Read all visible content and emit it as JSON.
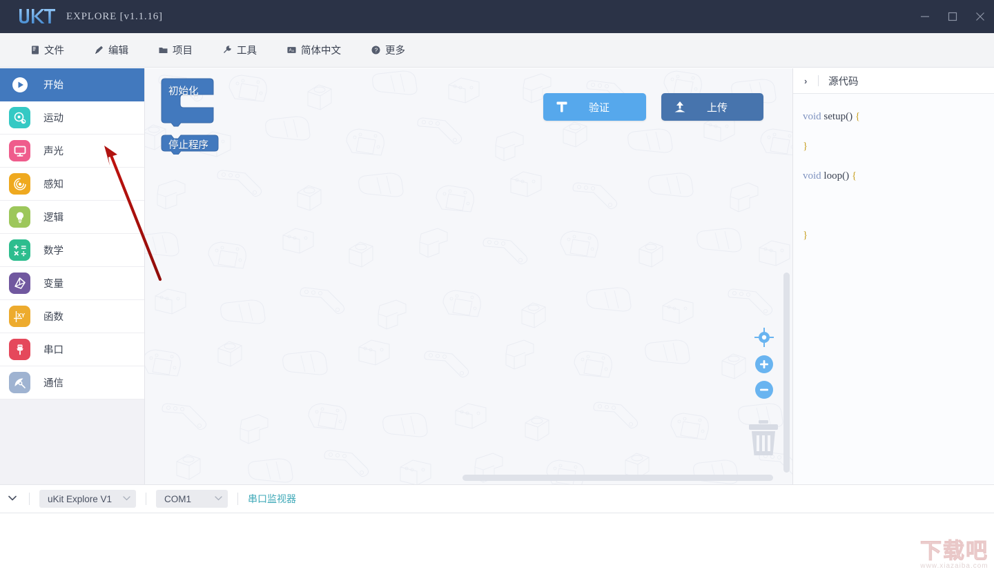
{
  "titlebar": {
    "logo_text": "UKIT",
    "app_title": "EXPLORE [v1.1.16]",
    "minimize": "minimize",
    "maximize": "maximize",
    "close": "close"
  },
  "menubar": {
    "items": [
      {
        "label": "文件",
        "icon": "file-icon"
      },
      {
        "label": "编辑",
        "icon": "edit-pen-icon"
      },
      {
        "label": "项目",
        "icon": "folder-icon"
      },
      {
        "label": "工具",
        "icon": "wrench-icon"
      },
      {
        "label": "简体中文",
        "icon": "language-icon"
      },
      {
        "label": "更多",
        "icon": "help-circle-icon"
      }
    ]
  },
  "sidebar": {
    "items": [
      {
        "label": "开始",
        "icon": "play-circle-icon",
        "color": "#ffffff",
        "active": true
      },
      {
        "label": "运动",
        "icon": "motion-icon",
        "color": "#35c9c4",
        "active": false
      },
      {
        "label": "声光",
        "icon": "display-icon",
        "color": "#ef5c8c",
        "active": false
      },
      {
        "label": "感知",
        "icon": "sensor-icon",
        "color": "#efa91f",
        "active": false
      },
      {
        "label": "逻辑",
        "icon": "bulb-icon",
        "color": "#9dc75b",
        "active": false
      },
      {
        "label": "数学",
        "icon": "math-icon",
        "color": "#2dbd8e",
        "active": false
      },
      {
        "label": "变量",
        "icon": "variable-icon",
        "color": "#71589f",
        "active": false
      },
      {
        "label": "函数",
        "icon": "function-xy-icon",
        "color": "#edab2e",
        "active": false
      },
      {
        "label": "串口",
        "icon": "usb-icon",
        "color": "#e5485b",
        "active": false
      },
      {
        "label": "通信",
        "icon": "satellite-icon",
        "color": "#9fb3d1",
        "active": false
      }
    ]
  },
  "canvas": {
    "blocks": [
      {
        "label": "初始化",
        "type": "c-block"
      },
      {
        "label": "停止程序",
        "type": "cap-block"
      }
    ],
    "buttons": [
      {
        "label": "验证",
        "icon": "hammer-icon",
        "color": "#56a8ec"
      },
      {
        "label": "上传",
        "icon": "upload-icon",
        "color": "#4774ad"
      }
    ],
    "controls": [
      {
        "name": "center-view",
        "icon": "crosshair-icon"
      },
      {
        "name": "zoom-in",
        "icon": "plus-icon"
      },
      {
        "name": "zoom-out",
        "icon": "minus-icon"
      }
    ],
    "trash": "trash-icon"
  },
  "code_panel": {
    "chevron": "›",
    "title": "源代码",
    "lines": [
      {
        "kw": "void",
        "fn": " setup() ",
        "brace": "{"
      },
      {
        "kw": "",
        "fn": "",
        "brace": "}"
      },
      {
        "kw": "void",
        "fn": " loop() ",
        "brace": "{"
      },
      {
        "kw": "",
        "fn": "",
        "brace": "}"
      }
    ],
    "code_text_1": "void",
    "code_text_2": " setup() ",
    "code_text_3": "{",
    "code_text_4": "}",
    "code_text_5": "void",
    "code_text_6": " loop() ",
    "code_text_7": "{",
    "code_text_8": "}"
  },
  "statusbar": {
    "chevron": "⌄",
    "board": {
      "value": "uKit Explore V1",
      "caret": "⌄"
    },
    "port": {
      "value": "COM1",
      "caret": "⌄"
    },
    "serial_monitor_link": "串口监视器"
  },
  "watermark": {
    "main": "下载吧",
    "sub": "www.xiazaiba.com"
  },
  "colors": {
    "titlebar_bg": "#2b3347",
    "menubar_bg": "#f3f4f6",
    "accent_blue": "#4279be",
    "verify_blue": "#56a8ec",
    "upload_blue": "#4774ad",
    "link_teal": "#3fa9b8",
    "annotation_red": "#c0130f",
    "canvas_bg": "#f6f7fa"
  }
}
